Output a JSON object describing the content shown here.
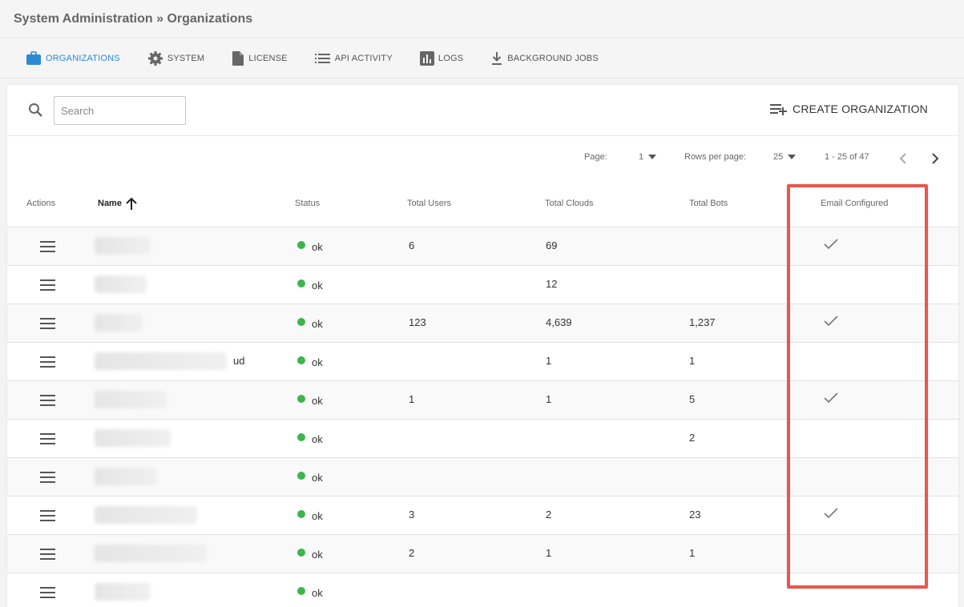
{
  "breadcrumb": "System Administration » Organizations",
  "tabs": [
    {
      "label": "ORGANIZATIONS",
      "icon": "briefcase-icon",
      "active": true
    },
    {
      "label": "SYSTEM",
      "icon": "gear-icon",
      "active": false
    },
    {
      "label": "LICENSE",
      "icon": "document-icon",
      "active": false
    },
    {
      "label": "API ACTIVITY",
      "icon": "list-icon",
      "active": false
    },
    {
      "label": "LOGS",
      "icon": "bar-chart-icon",
      "active": false
    },
    {
      "label": "BACKGROUND JOBS",
      "icon": "download-icon",
      "active": false
    }
  ],
  "search": {
    "placeholder": "Search",
    "value": ""
  },
  "create_button": "CREATE ORGANIZATION",
  "pagination": {
    "page_label": "Page:",
    "page_value": "1",
    "rows_label": "Rows per page:",
    "rows_value": "25",
    "range": "1 - 25 of 47"
  },
  "columns": {
    "actions": "Actions",
    "name": "Name",
    "status": "Status",
    "total_users": "Total Users",
    "total_clouds": "Total Clouds",
    "total_bots": "Total Bots",
    "email_configured": "Email Configured"
  },
  "rows": [
    {
      "name_suffix": "",
      "status": "ok",
      "users": "6",
      "clouds": "69",
      "bots": "",
      "email": true
    },
    {
      "name_suffix": "",
      "status": "ok",
      "users": "",
      "clouds": "12",
      "bots": "",
      "email": false
    },
    {
      "name_suffix": "",
      "status": "ok",
      "users": "123",
      "clouds": "4,639",
      "bots": "1,237",
      "email": true
    },
    {
      "name_suffix": "ud",
      "status": "ok",
      "users": "",
      "clouds": "1",
      "bots": "1",
      "email": false
    },
    {
      "name_suffix": "",
      "status": "ok",
      "users": "1",
      "clouds": "1",
      "bots": "5",
      "email": true
    },
    {
      "name_suffix": "",
      "status": "ok",
      "users": "",
      "clouds": "",
      "bots": "2",
      "email": false
    },
    {
      "name_suffix": "",
      "status": "ok",
      "users": "",
      "clouds": "",
      "bots": "",
      "email": false
    },
    {
      "name_suffix": "",
      "status": "ok",
      "users": "3",
      "clouds": "2",
      "bots": "23",
      "email": true
    },
    {
      "name_suffix": "",
      "status": "ok",
      "users": "2",
      "clouds": "1",
      "bots": "1",
      "email": false
    },
    {
      "name_suffix": "",
      "status": "ok",
      "users": "",
      "clouds": "",
      "bots": "",
      "email": false
    }
  ],
  "colors": {
    "accent": "#2a8ad4",
    "status_ok": "#3cb54a",
    "highlight": "#e8574e"
  }
}
